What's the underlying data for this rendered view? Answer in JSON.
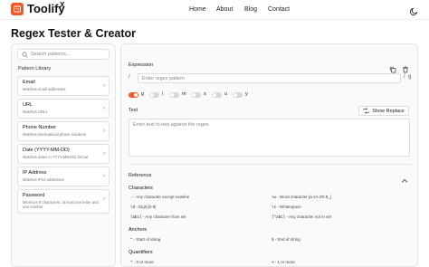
{
  "brand": {
    "name": "Toolify",
    "sup": "X",
    "accent": "#f15a24"
  },
  "nav": {
    "items": [
      "Home",
      "About",
      "Blog",
      "Contact"
    ]
  },
  "page": {
    "title": "Regex Tester & Creator"
  },
  "sidebar": {
    "search_placeholder": "Search patterns...",
    "library_label": "Pattern Library",
    "patterns": [
      {
        "name": "Email",
        "desc": "Matches email addresses"
      },
      {
        "name": "URL",
        "desc": "Matches URLs"
      },
      {
        "name": "Phone Number",
        "desc": "Matches international phone numbers"
      },
      {
        "name": "Date (YYYY-MM-DD)",
        "desc": "Matches dates in YYYY-MM-DD format"
      },
      {
        "name": "IP Address",
        "desc": "Matches IPv4 addresses"
      },
      {
        "name": "Password",
        "desc": "Minimum 8 characters, at least one letter and one number"
      }
    ]
  },
  "main": {
    "expression_label": "Expression",
    "regex_placeholder": "Enter regex pattern",
    "slash_open": "/",
    "slash_close": "/",
    "flags_suffix": "g",
    "flags": [
      {
        "char": "g",
        "on": true
      },
      {
        "char": "i",
        "on": false
      },
      {
        "char": "m",
        "on": false
      },
      {
        "char": "s",
        "on": false
      },
      {
        "char": "u",
        "on": false
      },
      {
        "char": "y",
        "on": false
      }
    ],
    "text_label": "Text",
    "show_replace_label": "Show Replace",
    "test_placeholder": "Enter text to test against the regex"
  },
  "reference": {
    "title": "Reference",
    "characters_title": "Characters",
    "characters": [
      {
        "code": ".",
        "desc": "- Any character except newline"
      },
      {
        "code": "\\w",
        "desc": "- Word character [a-zA-Z0-9_]"
      },
      {
        "code": "\\d",
        "desc": "- Digit [0-9]"
      },
      {
        "code": "\\s",
        "desc": "- Whitespace"
      },
      {
        "code": "[abc]",
        "desc": "- Any character from set"
      },
      {
        "code": "[^abc]",
        "desc": "- Any character not in set"
      }
    ],
    "anchors_title": "Anchors",
    "anchors": [
      {
        "code": "^",
        "desc": "- Start of string"
      },
      {
        "code": "$",
        "desc": "- End of string"
      }
    ],
    "quantifiers_title": "Quantifiers",
    "quantifiers": [
      {
        "code": "*",
        "desc": "- 0 or more"
      },
      {
        "code": "+",
        "desc": "- 1 or more"
      }
    ]
  }
}
